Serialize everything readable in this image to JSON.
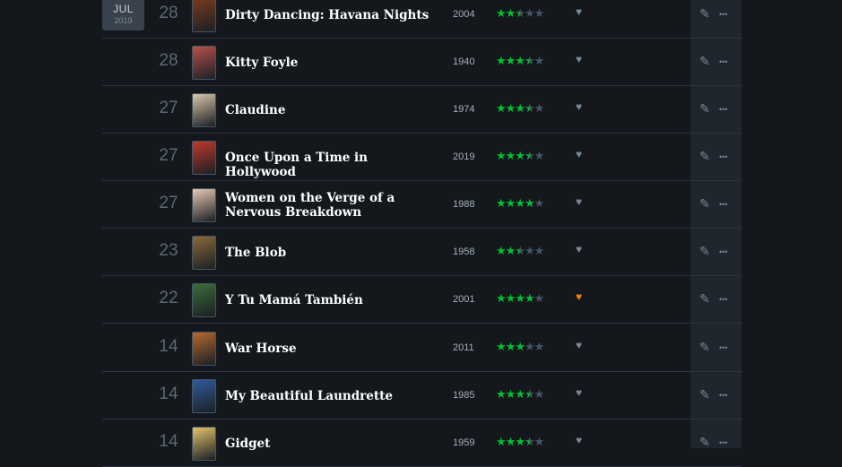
{
  "calendar": {
    "month": "JUL",
    "year": "2019"
  },
  "icons": {
    "edit": "pencil-icon",
    "more": "more-dots-icon",
    "like": "heart-icon"
  },
  "colors": {
    "star": "#00c030",
    "liked": "#ff8000",
    "unliked": "#778899"
  },
  "entries": [
    {
      "day": "28",
      "title": "Dirty Dancing: Havana Nights",
      "year": "2004",
      "rating": 2.5,
      "liked": false,
      "poster_color": "#7a3a1e"
    },
    {
      "day": "28",
      "title": "Kitty Foyle",
      "year": "1940",
      "rating": 3.5,
      "liked": false,
      "poster_color": "#b8524a"
    },
    {
      "day": "27",
      "title": "Claudine",
      "year": "1974",
      "rating": 3.5,
      "liked": false,
      "poster_color": "#d9c7a8"
    },
    {
      "day": "27",
      "title": "Once Upon a Time in Hollywood",
      "year": "2019",
      "rating": 3.5,
      "liked": false,
      "poster_color": "#c0392b"
    },
    {
      "day": "27",
      "title": "Women on the Verge of a Nervous Breakdown",
      "year": "1988",
      "rating": 4,
      "liked": false,
      "poster_color": "#e8c9b3"
    },
    {
      "day": "23",
      "title": "The Blob",
      "year": "1958",
      "rating": 2.5,
      "liked": false,
      "poster_color": "#8a6a3a"
    },
    {
      "day": "22",
      "title": "Y Tu Mamá También",
      "year": "2001",
      "rating": 4,
      "liked": true,
      "poster_color": "#3c6d3a"
    },
    {
      "day": "14",
      "title": "War Horse",
      "year": "2011",
      "rating": 3,
      "liked": false,
      "poster_color": "#b56a2e"
    },
    {
      "day": "14",
      "title": "My Beautiful Laundrette",
      "year": "1985",
      "rating": 3.5,
      "liked": false,
      "poster_color": "#2f5d9a"
    },
    {
      "day": "14",
      "title": "Gidget",
      "year": "1959",
      "rating": 3.5,
      "liked": false,
      "poster_color": "#e3c36b"
    }
  ]
}
